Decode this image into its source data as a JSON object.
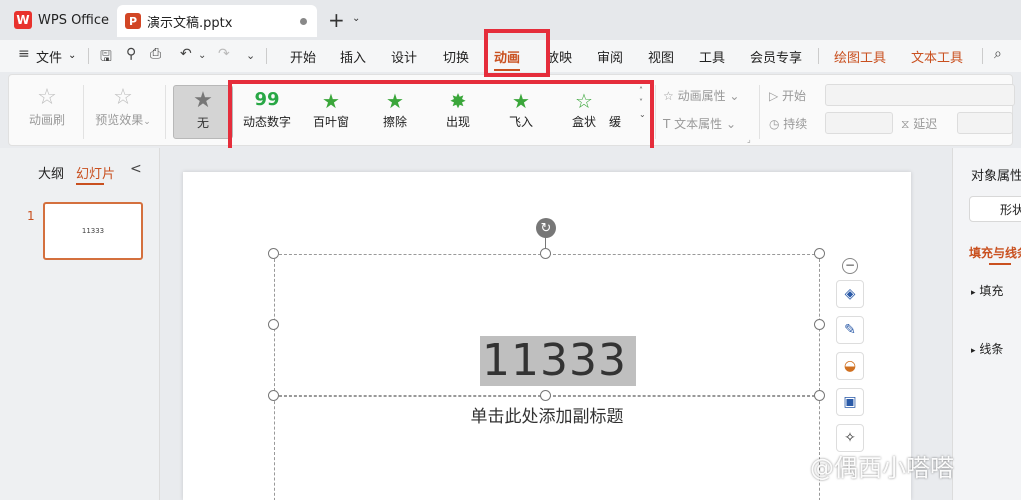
{
  "titlebar": {
    "app_tab": "WPS Office",
    "app_logo": "W",
    "doc_tab": "演示文稿.pptx",
    "doc_logo": "P",
    "new_tab": "+",
    "new_tab_dropdown": "⌄"
  },
  "menubar": {
    "file": "文件",
    "file_caret": "⌄",
    "tabs": [
      "开始",
      "插入",
      "设计",
      "切换",
      "动画",
      "放映",
      "审阅",
      "视图",
      "工具",
      "会员专享"
    ],
    "context_tabs": [
      "绘图工具",
      "文本工具"
    ],
    "active_tab": "动画"
  },
  "ribbon": {
    "animation_brush": "动画刷",
    "preview_effect": "预览效果",
    "none": "无",
    "effects": [
      {
        "label": "动态数字",
        "icon": "99"
      },
      {
        "label": "百叶窗",
        "icon": "★"
      },
      {
        "label": "擦除",
        "icon": "★"
      },
      {
        "label": "出现",
        "icon": "✸"
      },
      {
        "label": "飞入",
        "icon": "★"
      },
      {
        "label": "盒状",
        "icon": "☆"
      },
      {
        "label": "缓",
        "icon": ""
      }
    ],
    "animation_props": "动画属性",
    "text_props": "文本属性",
    "start": "开始",
    "duration": "持续",
    "delay": "延迟"
  },
  "left_panel": {
    "outline_tab": "大纲",
    "slides_tab": "幻灯片",
    "collapse": "<",
    "slide_number": "1",
    "thumbnail_text": "11333"
  },
  "slide": {
    "title": "11333",
    "subtitle_placeholder": "单击此处添加副标题"
  },
  "right_panel": {
    "title": "对象属性",
    "shape_button": "形状",
    "fill_line_tab": "填充与线条",
    "fill": "填充",
    "line": "线条"
  },
  "watermark": "@偶西小嗒嗒",
  "colors": {
    "accent": "#c9501f",
    "highlight_box": "#e52d3b",
    "effect_green": "#3aa63a"
  }
}
